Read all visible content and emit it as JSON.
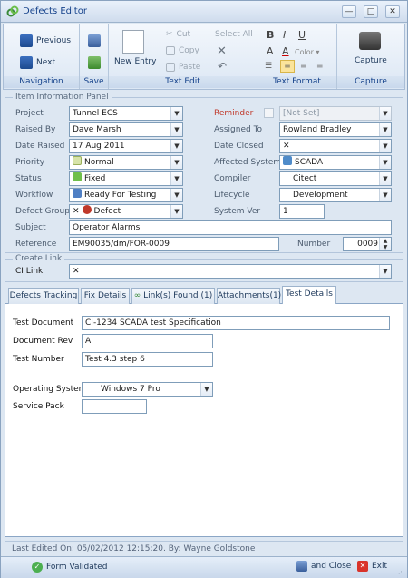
{
  "window": {
    "title": "Defects Editor",
    "min": "—",
    "max": "□",
    "close": "✕"
  },
  "ribbon": {
    "navigation": {
      "label": "Navigation",
      "previous": "Previous",
      "next": "Next"
    },
    "save": {
      "label": "Save"
    },
    "text_edit": {
      "label": "Text Edit",
      "new_entry": "New Entry",
      "cut": "Cut",
      "copy": "Copy",
      "paste": "Paste",
      "select_all": "Select All"
    },
    "text_format": {
      "label": "Text Format",
      "bold": "B",
      "italic": "I",
      "underline": "U",
      "grow_font": "A",
      "font_color": "A",
      "color": "Color"
    },
    "capture": {
      "label": "Capture",
      "capture": "Capture"
    }
  },
  "item_info": {
    "title": "Item Information Panel",
    "project": {
      "label": "Project",
      "value": "Tunnel ECS"
    },
    "raised_by": {
      "label": "Raised By",
      "value": "Dave Marsh"
    },
    "date_raised": {
      "label": "Date Raised",
      "value": "17 Aug 2011"
    },
    "priority": {
      "label": "Priority",
      "value": "Normal"
    },
    "status": {
      "label": "Status",
      "value": "Fixed"
    },
    "workflow": {
      "label": "Workflow",
      "value": "Ready For Testing"
    },
    "defect_group": {
      "label": "Defect Group",
      "value": "Defect"
    },
    "subject": {
      "label": "Subject",
      "value": "Operator Alarms"
    },
    "reference": {
      "label": "Reference",
      "value": "EM90035/dm/FOR-0009"
    },
    "reminder": {
      "label": "Reminder",
      "value": "[Not Set]"
    },
    "assigned_to": {
      "label": "Assigned To",
      "value": "Rowland Bradley"
    },
    "date_closed": {
      "label": "Date Closed",
      "value": ""
    },
    "affected_system": {
      "label": "Affected System",
      "value": "SCADA"
    },
    "compiler": {
      "label": "Compiler",
      "value": "Citect"
    },
    "lifecycle": {
      "label": "Lifecycle",
      "value": "Development"
    },
    "system_ver": {
      "label": "System Ver",
      "value": "1"
    },
    "number": {
      "label": "Number",
      "value": "0009"
    }
  },
  "create_link": {
    "title": "Create Link",
    "ci_link": {
      "label": "CI Link",
      "value": ""
    }
  },
  "tabs": [
    {
      "label": "Defects Tracking"
    },
    {
      "label": "Fix Details"
    },
    {
      "label": "Link(s) Found (1)"
    },
    {
      "label": "Attachments(1)"
    },
    {
      "label": "Test Details"
    }
  ],
  "test_details": {
    "test_document": {
      "label": "Test Document",
      "value": "CI-1234 SCADA test Specification"
    },
    "document_rev": {
      "label": "Document Rev",
      "value": "A"
    },
    "test_number": {
      "label": "Test Number",
      "value": "Test 4.3 step 6"
    },
    "operating_system": {
      "label": "Operating System",
      "value": "Windows 7 Pro"
    },
    "service_pack": {
      "label": "Service Pack",
      "value": ""
    }
  },
  "footer": {
    "last_edited": "Last Edited On: 05/02/2012 12:15:20. By: Wayne Goldstone",
    "status": "Form Validated",
    "save_close": "and Close",
    "exit": "Exit"
  }
}
